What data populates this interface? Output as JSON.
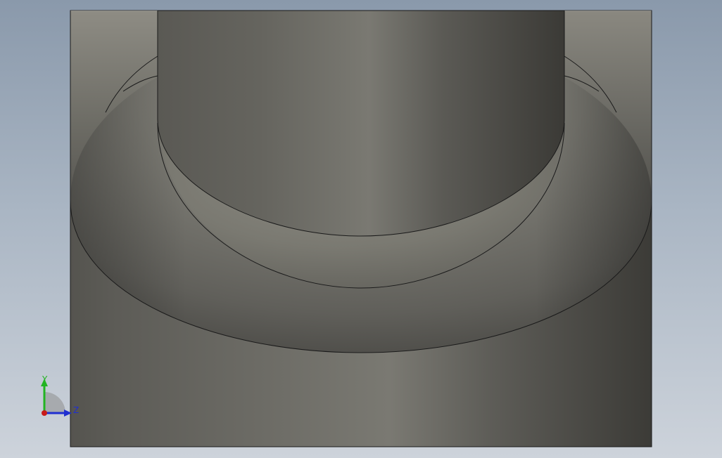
{
  "viewport": {
    "background_top": "#8a99ab",
    "background_bottom": "#cdd3db",
    "model_color": "#6b6a64",
    "edge_color": "#1a1a1a"
  },
  "triad": {
    "y_label": "Y",
    "z_label": "Z",
    "y_color": "#22b422",
    "z_color": "#1f2fd0",
    "x_color": "#c81a1a"
  }
}
